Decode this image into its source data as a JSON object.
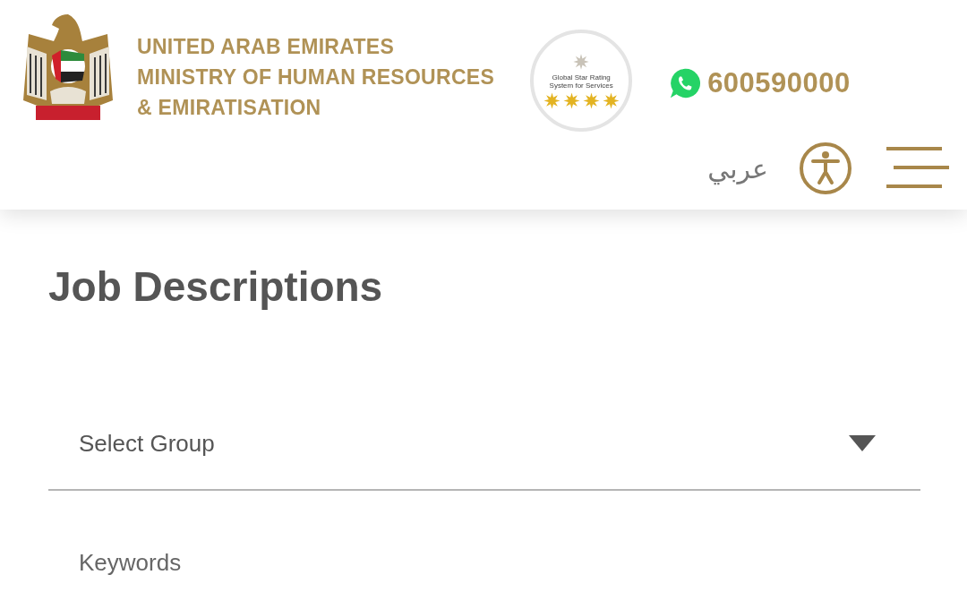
{
  "header": {
    "ministry_lines": [
      "UNITED ARAB EMIRATES",
      "MINISTRY OF HUMAN RESOURCES",
      "& EMIRATISATION"
    ],
    "badge": {
      "caption": "Global Star Rating System for Services",
      "stars": 4
    },
    "phone": "600590000",
    "language": "عربي"
  },
  "page_title": "Job Descriptions",
  "filters": [
    {
      "kind": "select",
      "placeholder": "Select Group"
    },
    {
      "kind": "text",
      "placeholder": "Keywords"
    }
  ]
}
